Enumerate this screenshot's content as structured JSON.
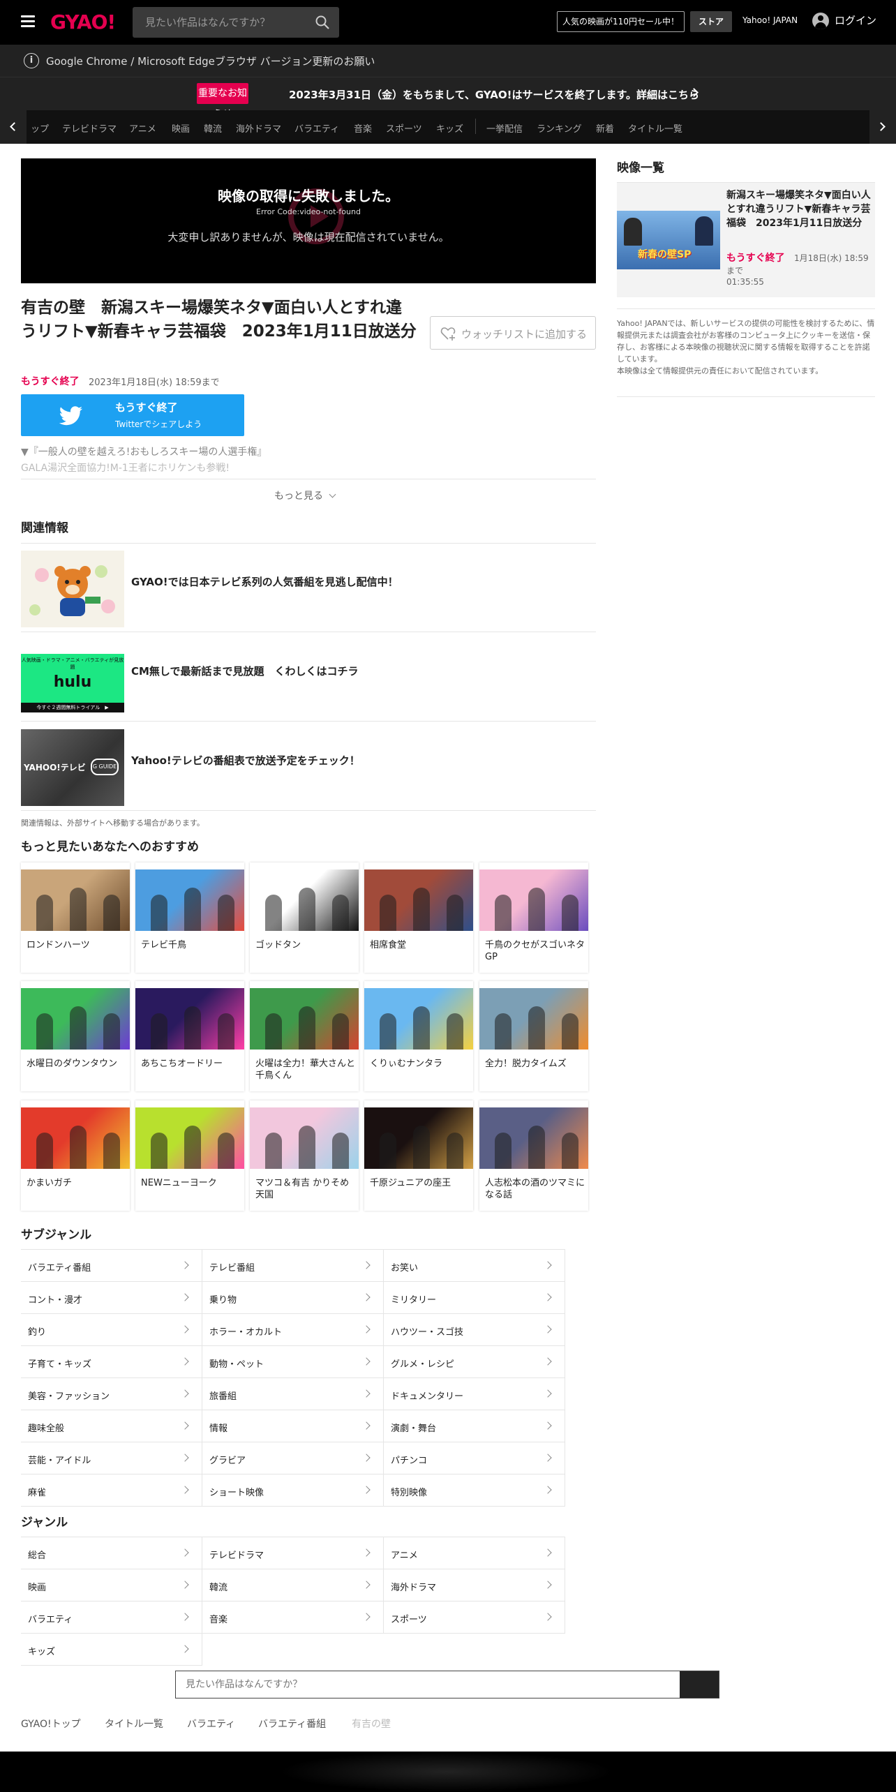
{
  "header": {
    "logo": "GYAO!",
    "search_placeholder": "見たい作品はなんですか？",
    "promo": "人気の映画が110円セール中！",
    "store": "ストア",
    "yahoo_japan": "Yahoo! JAPAN",
    "login": "ログイン"
  },
  "browser_notice": "Google Chrome / Microsoft Edgeブラウザ バージョン更新のお願い",
  "important": {
    "badge": "重要なお知らせ",
    "text": "2023年3月31日（金）をもちまして、GYAO!はサービスを終了します。詳細はこちら"
  },
  "genre_nav": [
    "ップ",
    "テレビドラマ",
    "アニメ",
    "映画",
    "韓流",
    "海外ドラマ",
    "バラエティ",
    "音楽",
    "スポーツ",
    "キッズ",
    "一挙配信",
    "ランキング",
    "新着",
    "タイトル一覧"
  ],
  "player": {
    "error_title": "映像の取得に失敗しました。",
    "error_code": "Error Code:video-not-found",
    "error_message": "大変申し訳ありませんが、映像は現在配信されていません。"
  },
  "episode": {
    "title": "有吉の壁　新潟スキー場爆笑ネタ▼面白い人とすれ違うリフト▼新春キャラ芸福袋　2023年1月11日放送分",
    "watchlist": "ウォッチリストに追加する",
    "soon": "もうすぐ終了",
    "until": "2023年1月18日(水) 18:59まで",
    "twitter_line1": "もうすぐ終了",
    "twitter_line2": "Twitterでシェアしよう",
    "desc1": "▼『一般人の壁を越えろ!おもしろスキー場の人選手権』",
    "desc2": "GALA湯沢全面協力!M-1王者にホリケンも参戦!",
    "more": "もっと見る"
  },
  "related": {
    "title": "関連情報",
    "items": [
      {
        "text": "GYAO!では日本テレビ系列の人気番組を見逃し配信中！"
      },
      {
        "text": "CM無しで最新話まで見放題　くわしくはコチラ",
        "thumb_top": "人気映画・ドラマ・アニメ・バラエティが見放題",
        "thumb_logo": "hulu",
        "thumb_bottom": "今すぐ２週間無料トライアル　▶"
      },
      {
        "text": "Yahoo!テレビの番組表で放送予定をチェック！",
        "thumb_logo": "YAHOO!テレビ",
        "thumb_sub": "G GUIDE"
      }
    ],
    "note": "関連情報は、外部サイトへ移動する場合があります。"
  },
  "recommend": {
    "title": "もっと見たいあなたへのおすすめ",
    "items": [
      "ロンドンハーツ",
      "テレビ千鳥",
      "ゴッドタン",
      "相席食堂",
      "千鳥のクセがスゴいネタGP",
      "水曜日のダウンタウン",
      "あちこちオードリー",
      "火曜は全力！華大さんと千鳥くん",
      "くりぃむナンタラ",
      "全力！脱力タイムズ",
      "かまいガチ",
      "NEWニューヨーク",
      "マツコ＆有吉 かりそめ天国",
      "千原ジュニアの座王",
      "人志松本の酒のツマミになる話"
    ]
  },
  "subgenre": {
    "title": "サブジャンル",
    "items": [
      "バラエティ番組",
      "テレビ番組",
      "お笑い",
      "コント・漫才",
      "乗り物",
      "ミリタリー",
      "釣り",
      "ホラー・オカルト",
      "ハウツー・スゴ技",
      "子育て・キッズ",
      "動物・ペット",
      "グルメ・レシピ",
      "美容・ファッション",
      "旅番組",
      "ドキュメンタリー",
      "趣味全般",
      "情報",
      "演劇・舞台",
      "芸能・アイドル",
      "グラビア",
      "パチンコ",
      "麻雀",
      "ショート映像",
      "特別映像"
    ]
  },
  "genre": {
    "title": "ジャンル",
    "items": [
      "総合",
      "テレビドラマ",
      "アニメ",
      "映画",
      "韓流",
      "海外ドラマ",
      "バラエティ",
      "音楽",
      "スポーツ",
      "キッズ"
    ]
  },
  "bottom_search_placeholder": "見たい作品はなんですか？",
  "breadcrumb": [
    "GYAO!トップ",
    "タイトル一覧",
    "バラエティ",
    "バラエティ番組",
    "有吉の壁"
  ],
  "sidebar": {
    "title": "映像一覧",
    "item": {
      "title": "新潟スキー場爆笑ネタ▼面白い人とすれ違うリフト▼新春キャラ芸福袋　2023年1月11日放送分",
      "soon": "もうすぐ終了",
      "date": "1月18日(水) 18:59",
      "until": "まで",
      "duration": "01:35:55",
      "thumb_text": "新春の壁SP"
    },
    "note": "Yahoo! JAPANでは、新しいサービスの提供の可能性を検討するために、情報提供元または調査会社がお客様のコンピュータ上にクッキーを送信・保存し、お客様による本映像の視聴状況に関する情報を取得することを許諾しています。\n本映像は全て情報提供元の責任において配信されています。"
  },
  "colors": {
    "accent": "#e5004f",
    "twitter": "#1da1f2",
    "hulu": "#1ce783"
  }
}
